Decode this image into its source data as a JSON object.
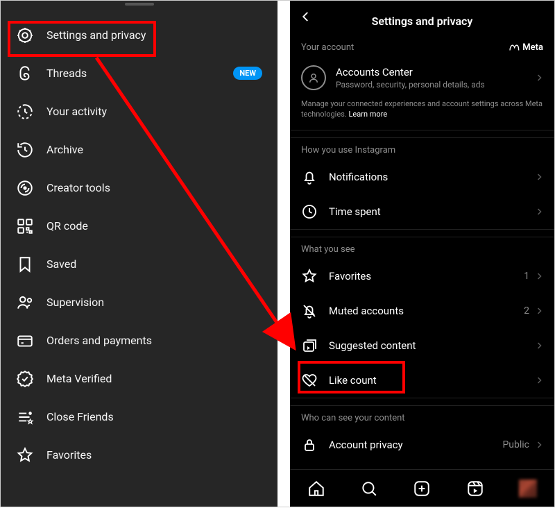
{
  "left_panel": {
    "items": [
      {
        "label": "Settings and privacy",
        "icon": "gear"
      },
      {
        "label": "Threads",
        "icon": "threads",
        "badge": "NEW"
      },
      {
        "label": "Your activity",
        "icon": "activity"
      },
      {
        "label": "Archive",
        "icon": "archive"
      },
      {
        "label": "Creator tools",
        "icon": "creator"
      },
      {
        "label": "QR code",
        "icon": "qr"
      },
      {
        "label": "Saved",
        "icon": "saved"
      },
      {
        "label": "Supervision",
        "icon": "supervision"
      },
      {
        "label": "Orders and payments",
        "icon": "payments"
      },
      {
        "label": "Meta Verified",
        "icon": "verified"
      },
      {
        "label": "Close Friends",
        "icon": "closefriends"
      },
      {
        "label": "Favorites",
        "icon": "favorites"
      }
    ]
  },
  "right_panel": {
    "title": "Settings and privacy",
    "your_account_label": "Your account",
    "meta_label": "Meta",
    "accounts_center": {
      "title": "Accounts Center",
      "subtitle": "Password, security, personal details, ads"
    },
    "description": "Manage your connected experiences and account settings across Meta technologies.",
    "learn_more": "Learn more",
    "sections": {
      "how_you_use": "How you use Instagram",
      "what_you_see": "What you see",
      "who_can_see": "Who can see your content"
    },
    "items": {
      "notifications": "Notifications",
      "time_spent": "Time spent",
      "favorites": "Favorites",
      "favorites_count": "1",
      "muted": "Muted accounts",
      "muted_count": "2",
      "suggested": "Suggested content",
      "like_count": "Like count",
      "account_privacy": "Account privacy",
      "account_privacy_value": "Public"
    }
  }
}
